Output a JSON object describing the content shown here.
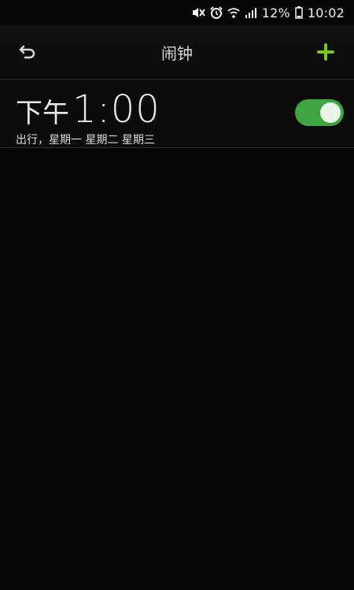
{
  "status_bar": {
    "battery_percent": "12%",
    "time": "10:02",
    "icons": [
      "mute-icon",
      "alarm-icon",
      "wifi-icon",
      "signal-icon",
      "battery-icon"
    ]
  },
  "header": {
    "title": "闹钟",
    "back_icon": "back-arrow-icon",
    "add_icon": "plus-icon",
    "accent_color": "#7cc31a"
  },
  "alarms": [
    {
      "ampm": "下午",
      "time": "1:00",
      "description": "出行，星期一 星期二 星期三",
      "enabled": true,
      "toggle_color": "#3fa63f"
    }
  ]
}
